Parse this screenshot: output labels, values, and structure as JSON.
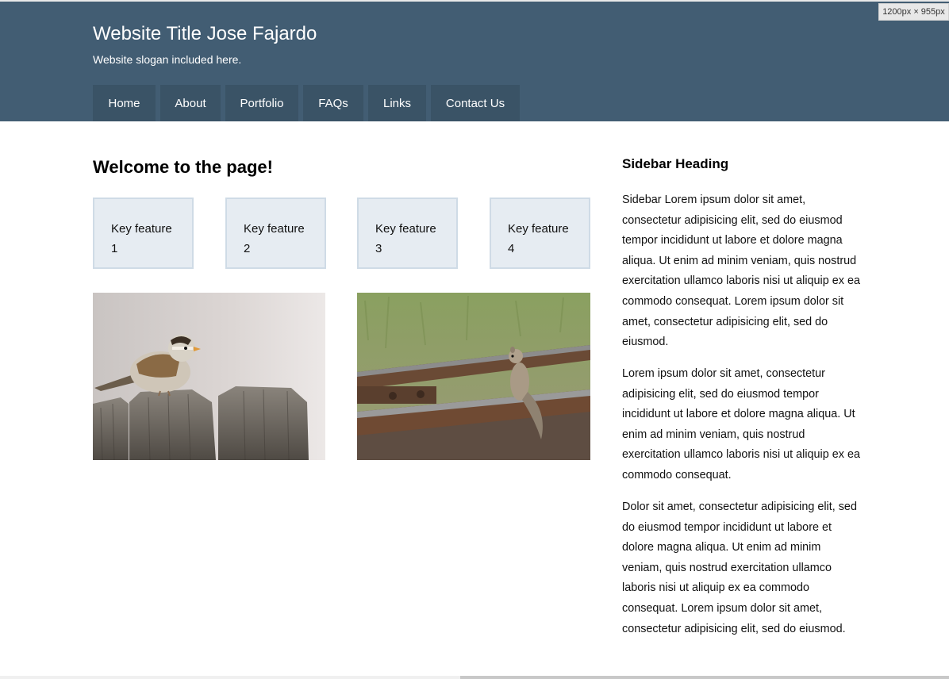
{
  "header": {
    "title": "Website Title Jose Fajardo",
    "slogan": "Website slogan included here.",
    "nav": [
      {
        "label": "Home"
      },
      {
        "label": "About"
      },
      {
        "label": "Portfolio"
      },
      {
        "label": "FAQs"
      },
      {
        "label": "Links"
      },
      {
        "label": "Contact Us"
      }
    ],
    "bg_color": "#425d73",
    "nav_color": "#3a5366"
  },
  "viewport_badge": "1200px × 955px",
  "main": {
    "heading": "Welcome to the page!",
    "features": [
      {
        "line1": "Key feature",
        "line2": "1"
      },
      {
        "line1": "Key feature",
        "line2": "2"
      },
      {
        "line1": "Key feature",
        "line2": "3"
      },
      {
        "line1": "Key feature",
        "line2": "4"
      }
    ],
    "images": [
      {
        "subject": "sparrow on wooden fence"
      },
      {
        "subject": "squirrel on railroad track"
      }
    ]
  },
  "sidebar": {
    "heading": "Sidebar Heading",
    "paragraphs": [
      "Sidebar Lorem ipsum dolor sit amet, consectetur adipisicing elit, sed do eiusmod tempor incididunt ut labore et dolore magna aliqua. Ut enim ad minim veniam, quis nostrud exercitation ullamco laboris nisi ut aliquip ex ea commodo consequat. Lorem ipsum dolor sit amet, consectetur adipisicing elit, sed do eiusmod.",
      "Lorem ipsum dolor sit amet, consectetur adipisicing elit, sed do eiusmod tempor incididunt ut labore et dolore magna aliqua. Ut enim ad minim veniam, quis nostrud exercitation ullamco laboris nisi ut aliquip ex ea commodo consequat.",
      "Dolor sit amet, consectetur adipisicing elit, sed do eiusmod tempor incididunt ut labore et dolore magna aliqua. Ut enim ad minim veniam, quis nostrud exercitation ullamco laboris nisi ut aliquip ex ea commodo consequat. Lorem ipsum dolor sit amet, consectetur adipisicing elit, sed do eiusmod."
    ]
  }
}
